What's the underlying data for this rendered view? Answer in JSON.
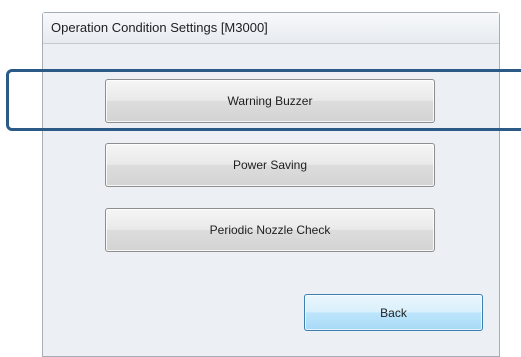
{
  "window": {
    "title": "Operation Condition Settings [M3000]"
  },
  "buttons": {
    "warning_buzzer": "Warning Buzzer",
    "power_saving": "Power Saving",
    "periodic_nozzle_check": "Periodic Nozzle Check",
    "back": "Back"
  },
  "colors": {
    "highlight_border": "#2b5a87",
    "default_button_border": "#3c7fb1"
  }
}
